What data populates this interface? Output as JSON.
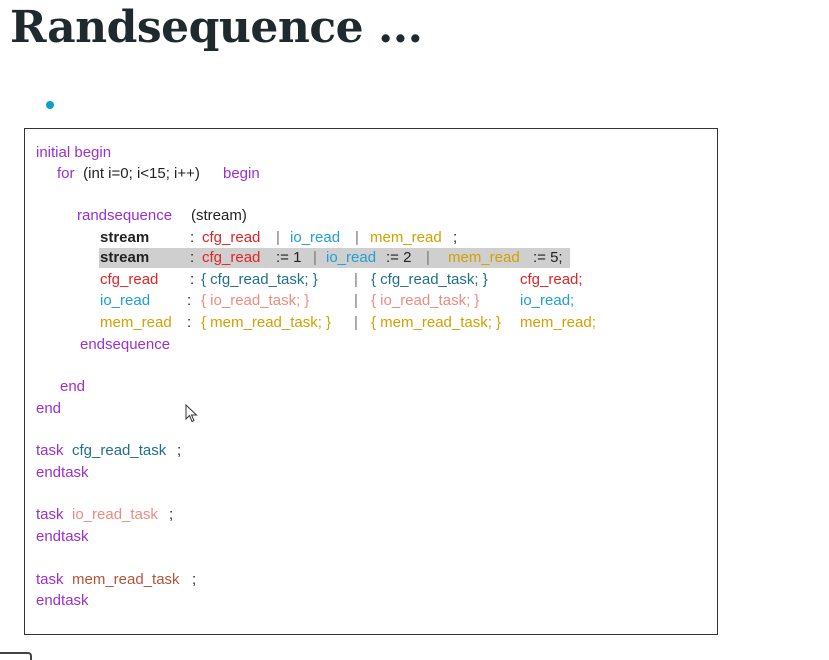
{
  "title": "Randsequence ...",
  "code": {
    "initial_begin": "initial begin",
    "for_for": "for",
    "for_args": " (int i=0; i<15; i++)",
    "for_begin": "begin",
    "randseq_kw": "randsequence",
    "randseq_arg": "(stream)",
    "stream": "stream",
    "colon": ":",
    "cfg_read": "cfg_read",
    "io_read": "io_read",
    "mem_read": "mem_read",
    "pipe": "|",
    "semicolon": ";",
    "w1": ":= 1",
    "w2": ":= 2",
    "w5": ":= 5;",
    "open_cfg_task": "{ cfg_read_task; }",
    "open_io_task": "{ io_read_task; }",
    "open_mem_task": "{ mem_read_task; }",
    "cfg_read_semi": "cfg_read;",
    "io_read_semi": "io_read;",
    "mem_read_semi": "mem_read;",
    "endsequence": "endsequence",
    "end": "end",
    "task": "task",
    "endtask": "endtask",
    "cfg_read_task": "cfg_read_task",
    "io_read_task": "io_read_task",
    "mem_read_task": "mem_read_task"
  }
}
